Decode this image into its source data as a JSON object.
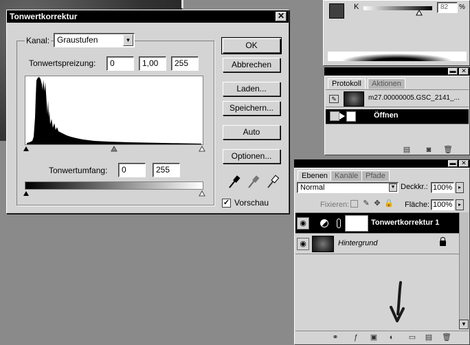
{
  "levels_dialog": {
    "title": "Tonwertkorrektur",
    "close_symbol": "✕",
    "channel_label": "Kanal:",
    "channel_value": "Graustufen",
    "input_levels_label": "Tonwertspreizung:",
    "input_black": "0",
    "input_gamma": "1,00",
    "input_white": "255",
    "output_levels_label": "Tonwertumfang:",
    "output_black": "0",
    "output_white": "255",
    "buttons": {
      "ok": "OK",
      "cancel": "Abbrechen",
      "load": "Laden...",
      "save": "Speichern...",
      "auto": "Auto",
      "options": "Optionen..."
    },
    "preview_label": "Vorschau",
    "preview_checked": true,
    "check_symbol": "✓"
  },
  "color_panel": {
    "channel_letter": "K",
    "value": "82",
    "unit": "%",
    "foreground_color": "#404040",
    "background_color": "#ffffff"
  },
  "history_panel": {
    "tabs": [
      "Protokoll",
      "Aktionen"
    ],
    "snapshot_name": "m27.00000005.GSC_2141_...",
    "step_name": "Öffnen"
  },
  "layers_panel": {
    "tabs": [
      "Ebenen",
      "Kanäle",
      "Pfade"
    ],
    "blend_mode": "Normal",
    "opacity_label": "Deckkr.:",
    "opacity_value": "100%",
    "lock_label": "Fixieren:",
    "fill_label": "Fläche:",
    "fill_value": "100%",
    "layers": [
      {
        "name": "Tonwertkorrektur 1",
        "selected": true
      },
      {
        "name": "Hintergrund",
        "selected": false
      }
    ]
  },
  "icons": {
    "eye": "eye-icon",
    "lock": "lock-icon",
    "arrow": "hand-drawn-arrow"
  },
  "annotation_arrow_color": "#1a1a1a"
}
